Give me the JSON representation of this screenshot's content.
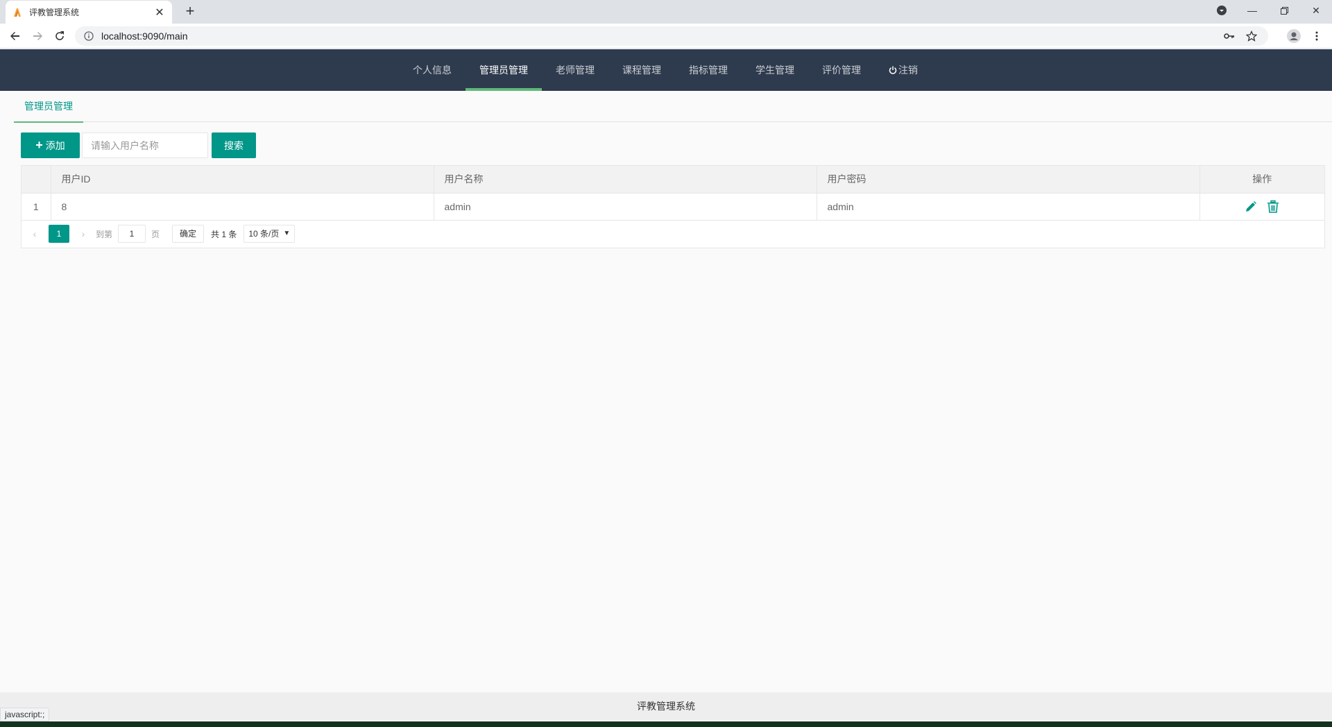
{
  "browser": {
    "tab_title": "评教管理系统",
    "url": "localhost:9090/main",
    "status_text": "javascript:;"
  },
  "nav": {
    "items": [
      {
        "label": "个人信息"
      },
      {
        "label": "管理员管理"
      },
      {
        "label": "老师管理"
      },
      {
        "label": "课程管理"
      },
      {
        "label": "指标管理"
      },
      {
        "label": "学生管理"
      },
      {
        "label": "评价管理"
      },
      {
        "label": "注销"
      }
    ],
    "active_index": 1
  },
  "page": {
    "tab_label": "管理员管理",
    "add_label": "添加",
    "search_placeholder": "请输入用户名称",
    "search_label": "搜索"
  },
  "table": {
    "headers": [
      "用户ID",
      "用户名称",
      "用户密码",
      "操作"
    ],
    "rows": [
      {
        "num": "1",
        "id": "8",
        "name": "admin",
        "password": "admin"
      }
    ]
  },
  "pager": {
    "current": "1",
    "goto_prefix": "到第",
    "goto_value": "1",
    "goto_suffix": "页",
    "confirm": "确定",
    "total": "共 1 条",
    "page_size": "10 条/页"
  },
  "footer": {
    "text": "评教管理系统"
  },
  "colors": {
    "header_bg": "#2e3b4e",
    "accent": "#009688",
    "active_underline": "#5fb878"
  }
}
